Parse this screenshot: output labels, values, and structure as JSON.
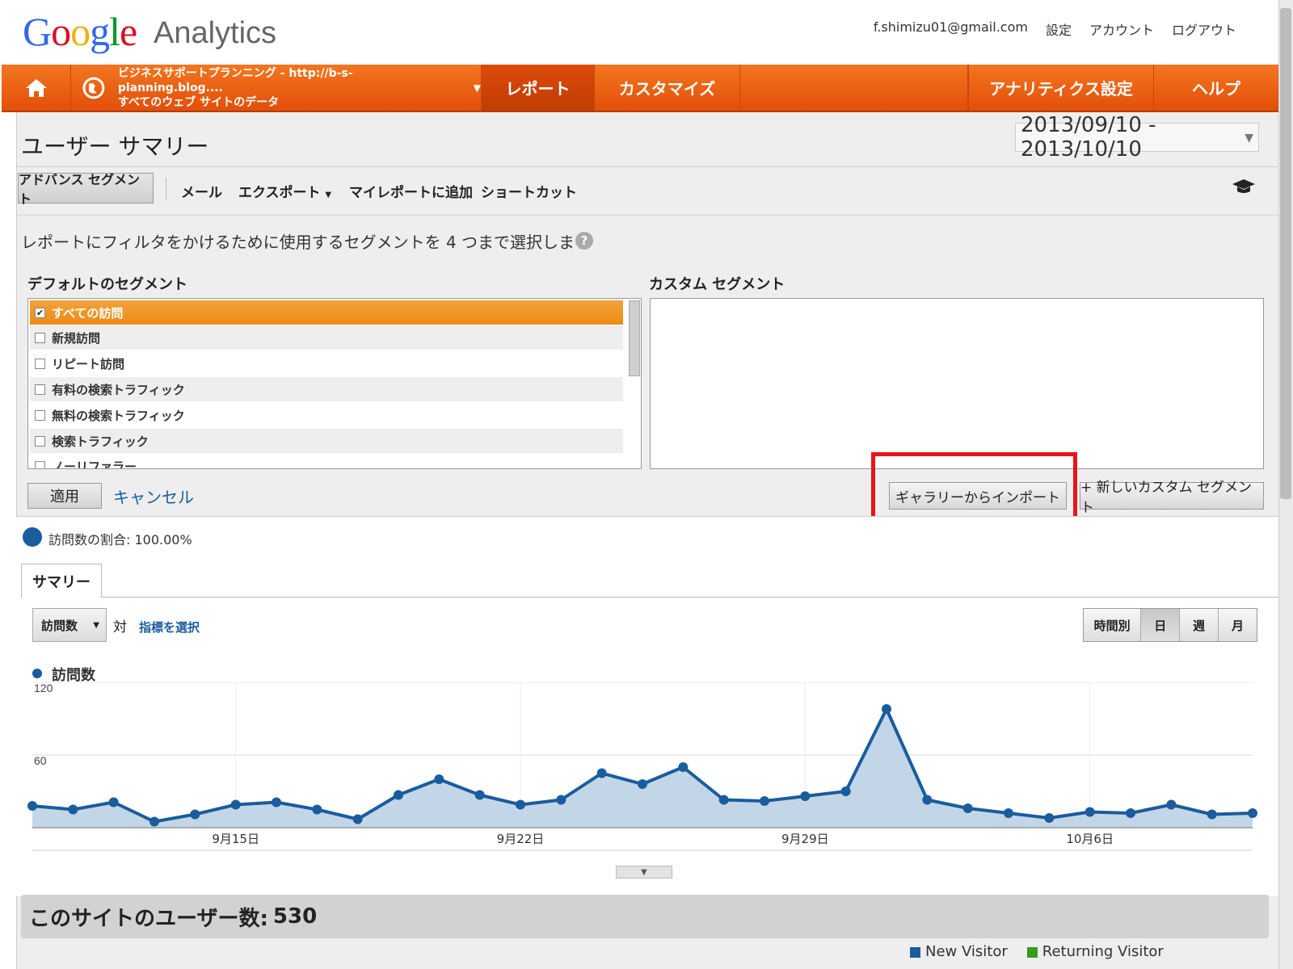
{
  "header": {
    "logo": "Google",
    "product": "Analytics",
    "email": "f.shimizu01@gmail.com",
    "links": [
      "設定",
      "アカウント",
      "ログアウト"
    ]
  },
  "nav": {
    "site_line1": "ビジネスサポートプランニング - http://b-s-planning.blog....",
    "site_line2": "すべてのウェブ サイトのデータ",
    "report": "レポート",
    "customize": "カスタマイズ",
    "analytics_settings": "アナリティクス設定",
    "help": "ヘルプ"
  },
  "page": {
    "title": "ユーザー サマリー",
    "date_range": "2013/09/10 - 2013/10/10"
  },
  "toolbar": {
    "advanced_segment": "アドバンス セグメント",
    "mail": "メール",
    "export": "エクスポート",
    "add_to_dashboard": "マイレポートに追加",
    "shortcut": "ショートカット"
  },
  "segments": {
    "instruction": "レポートにフィルタをかけるために使用するセグメントを 4 つまで選択します",
    "default_heading": "デフォルトのセグメント",
    "custom_heading": "カスタム セグメント",
    "default_items": [
      {
        "label": "すべての訪問",
        "checked": true
      },
      {
        "label": "新規訪問",
        "checked": false
      },
      {
        "label": "リピート訪問",
        "checked": false
      },
      {
        "label": "有料の検索トラフィック",
        "checked": false
      },
      {
        "label": "無料の検索トラフィック",
        "checked": false
      },
      {
        "label": "検索トラフィック",
        "checked": false
      },
      {
        "label": "ノーリファラー",
        "checked": false
      }
    ],
    "apply": "適用",
    "cancel": "キャンセル",
    "import_gallery": "ギャラリーからインポート",
    "new_custom_segment": "+ 新しいカスタム セグメント"
  },
  "summary": {
    "visit_share": "訪問数の割合: 100.00%",
    "tab": "サマリー",
    "metric": "訪問数",
    "vs": "対",
    "pick_metric": "指標を選択",
    "periods": [
      "時間別",
      "日",
      "週",
      "月"
    ],
    "active_period": "日",
    "legend": "訪問数"
  },
  "users": {
    "label": "このサイトのユーザー数:",
    "count": "530"
  },
  "pie_legend": [
    {
      "name": "New Visitor",
      "color": "#1a5c9e"
    },
    {
      "name": "Returning Visitor",
      "color": "#3a9a1e"
    }
  ],
  "chart_data": {
    "type": "area",
    "series": [
      {
        "name": "訪問数",
        "values": [
          18,
          15,
          21,
          5,
          11,
          19,
          21,
          15,
          7,
          27,
          40,
          27,
          19,
          23,
          45,
          36,
          50,
          23,
          22,
          26,
          30,
          98,
          23,
          16,
          12,
          8,
          13,
          12,
          19,
          11,
          12
        ]
      }
    ],
    "x": [
      "9/10",
      "9/11",
      "9/12",
      "9/13",
      "9/14",
      "9/15",
      "9/16",
      "9/17",
      "9/18",
      "9/19",
      "9/20",
      "9/21",
      "9/22",
      "9/23",
      "9/24",
      "9/25",
      "9/26",
      "9/27",
      "9/28",
      "9/29",
      "9/30",
      "10/1",
      "10/2",
      "10/3",
      "10/4",
      "10/5",
      "10/6",
      "10/7",
      "10/8",
      "10/9",
      "10/10"
    ],
    "x_tick_labels": [
      "9月15日",
      "9月22日",
      "9月29日",
      "10月6日"
    ],
    "x_tick_indices": [
      5,
      12,
      19,
      26
    ],
    "y_ticks": [
      60,
      120
    ],
    "ylim": [
      0,
      120
    ],
    "line_color": "#1a5c9e",
    "fill_color": "#bcd2e6"
  }
}
